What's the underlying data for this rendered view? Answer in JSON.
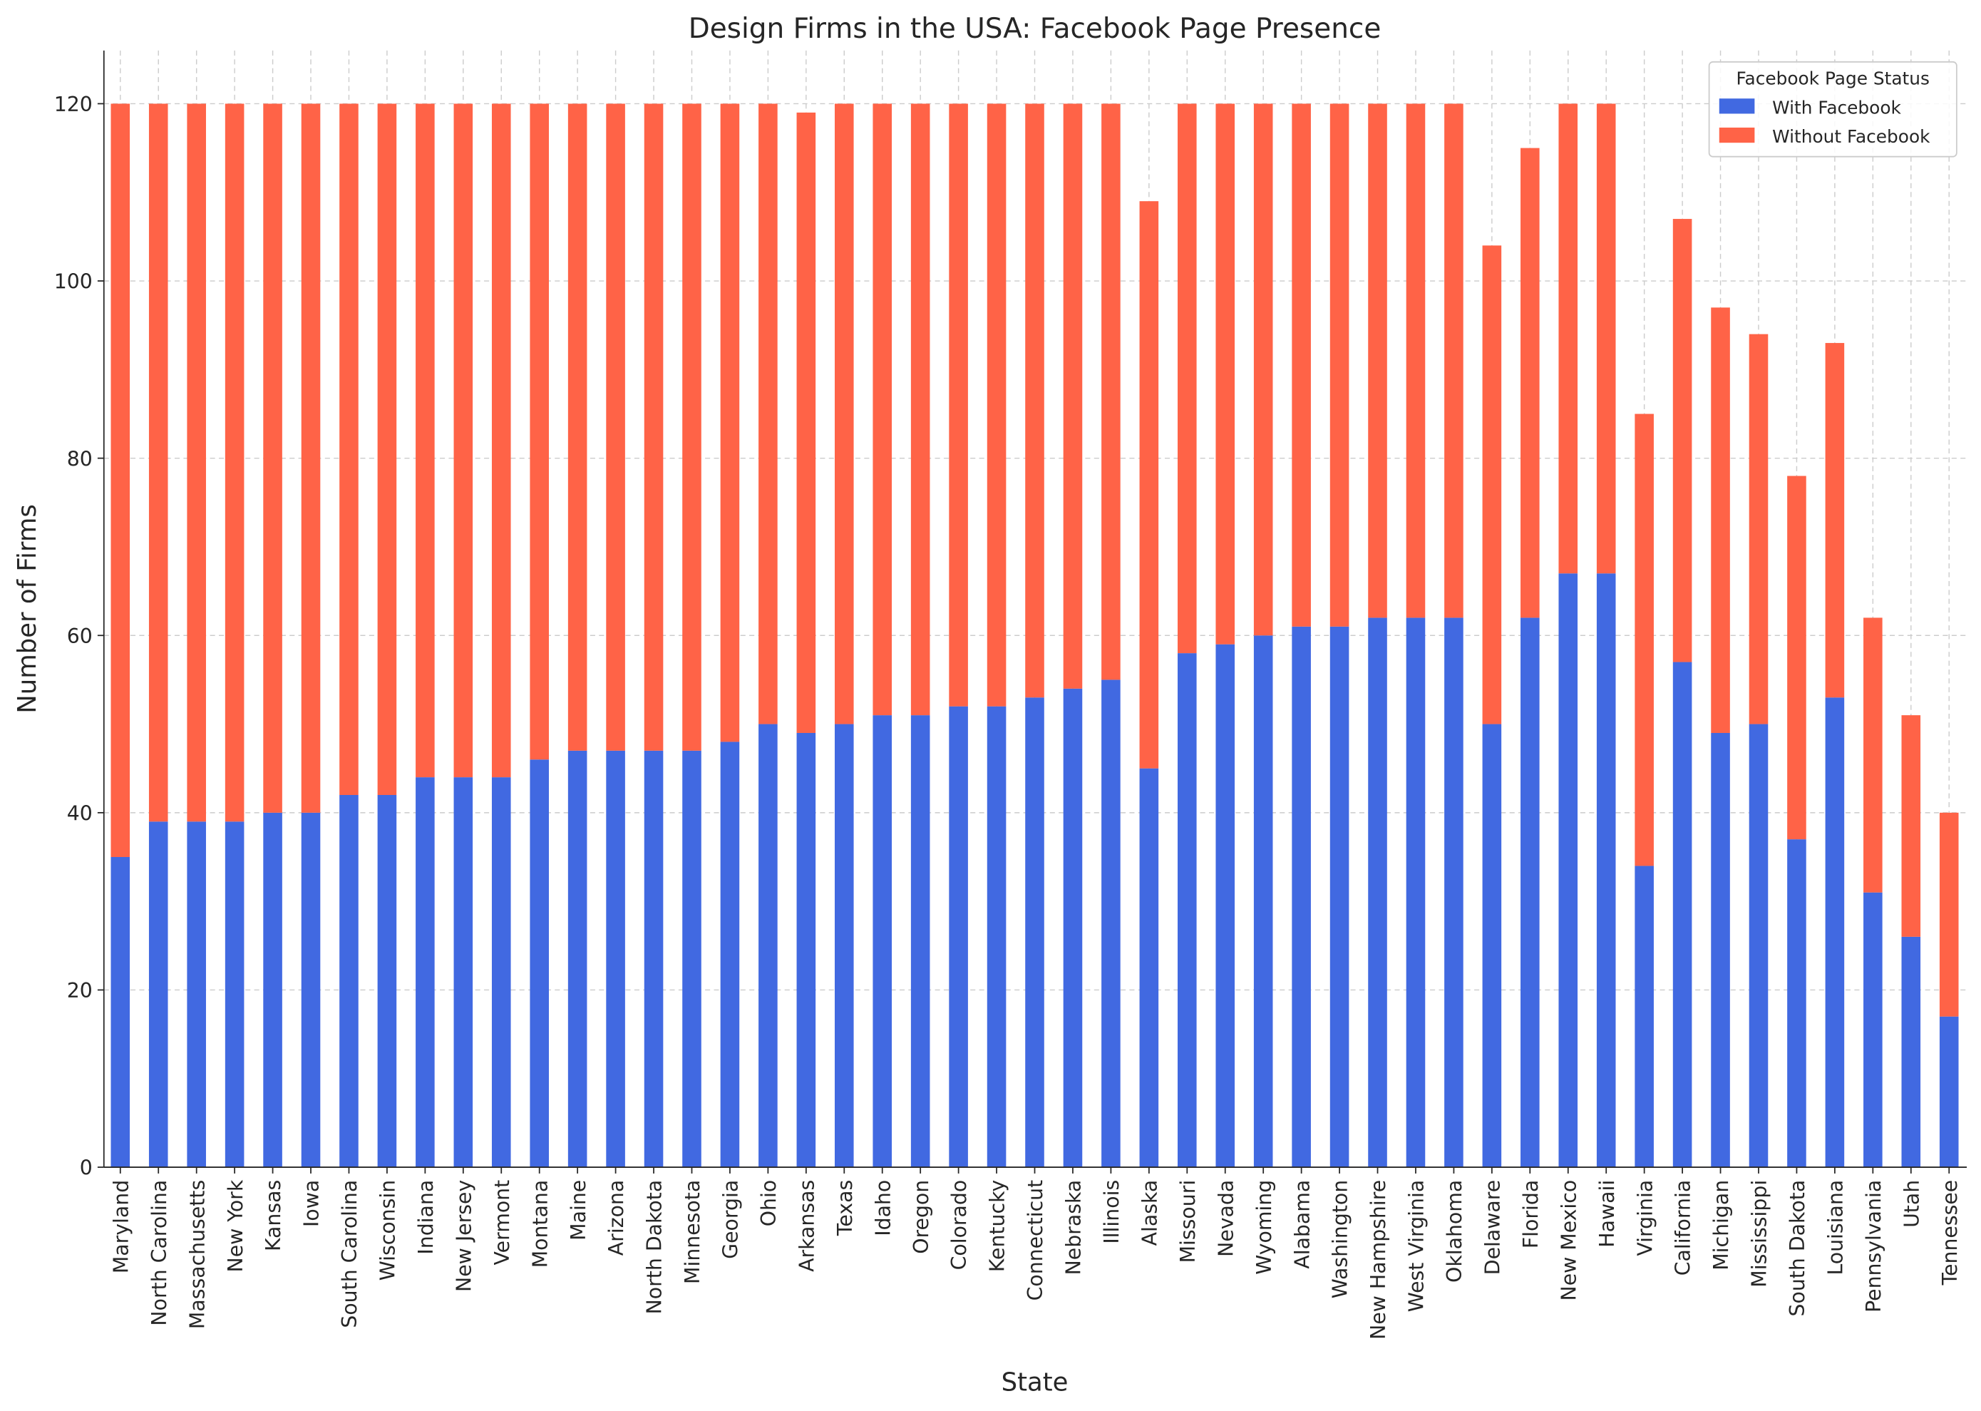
{
  "chart_data": {
    "type": "bar",
    "stacked": true,
    "title": "Design Firms in the USA: Facebook Page Presence",
    "xlabel": "State",
    "ylabel": "Number of Firms",
    "ylim": [
      0,
      126
    ],
    "yticks": [
      0,
      20,
      40,
      60,
      80,
      100,
      120
    ],
    "grid": true,
    "legend": {
      "title": "Facebook Page Status",
      "placement": "top-right"
    },
    "categories": [
      "Maryland",
      "North Carolina",
      "Massachusetts",
      "New York",
      "Kansas",
      "Iowa",
      "South Carolina",
      "Wisconsin",
      "Indiana",
      "New Jersey",
      "Vermont",
      "Montana",
      "Maine",
      "Arizona",
      "North Dakota",
      "Minnesota",
      "Georgia",
      "Ohio",
      "Arkansas",
      "Texas",
      "Idaho",
      "Oregon",
      "Colorado",
      "Kentucky",
      "Connecticut",
      "Nebraska",
      "Illinois",
      "Alaska",
      "Missouri",
      "Nevada",
      "Wyoming",
      "Alabama",
      "Washington",
      "New Hampshire",
      "West Virginia",
      "Oklahoma",
      "Delaware",
      "Florida",
      "New Mexico",
      "Hawaii",
      "Virginia",
      "California",
      "Michigan",
      "Mississippi",
      "South Dakota",
      "Louisiana",
      "Pennsylvania",
      "Utah",
      "Tennessee"
    ],
    "series": [
      {
        "name": "With Facebook",
        "color": "#4169E1",
        "values": [
          35,
          39,
          39,
          39,
          40,
          40,
          42,
          42,
          44,
          44,
          44,
          46,
          47,
          47,
          47,
          47,
          48,
          50,
          49,
          50,
          51,
          51,
          52,
          52,
          53,
          54,
          55,
          45,
          58,
          59,
          60,
          61,
          61,
          62,
          62,
          62,
          50,
          62,
          67,
          67,
          34,
          57,
          49,
          50,
          37,
          53,
          31,
          26,
          17
        ]
      },
      {
        "name": "Without Facebook",
        "color": "#FF6347",
        "values": [
          85,
          81,
          81,
          81,
          80,
          80,
          78,
          78,
          76,
          76,
          76,
          74,
          73,
          73,
          73,
          73,
          72,
          70,
          70,
          70,
          69,
          69,
          68,
          68,
          67,
          66,
          65,
          64,
          62,
          61,
          60,
          59,
          59,
          58,
          58,
          58,
          54,
          53,
          53,
          53,
          51,
          50,
          48,
          44,
          41,
          40,
          31,
          25,
          23
        ]
      }
    ]
  }
}
